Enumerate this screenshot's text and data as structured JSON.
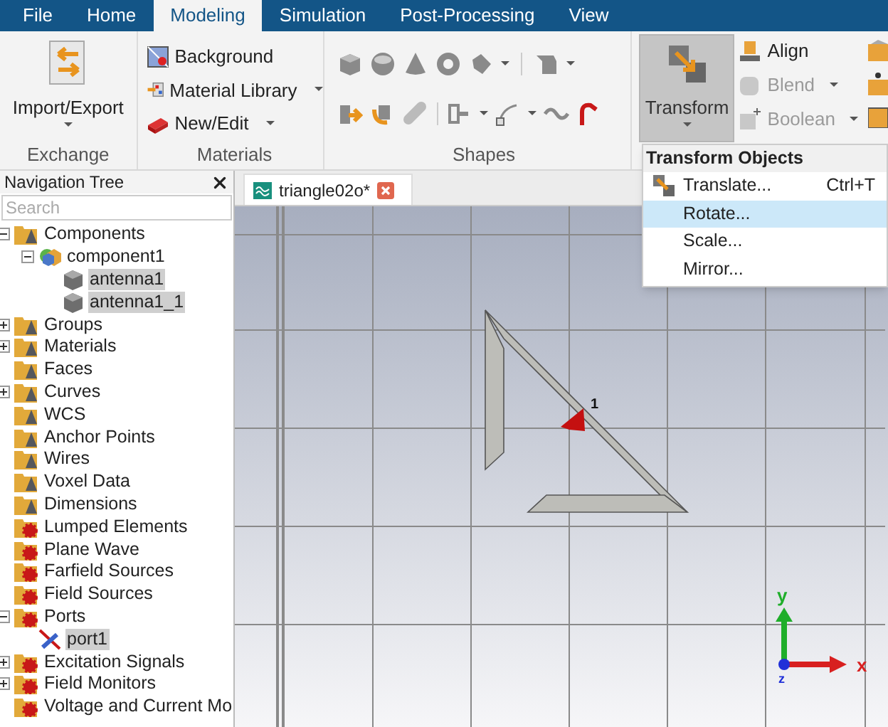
{
  "menu_bar": {
    "tabs": [
      {
        "label": "File",
        "selected": false
      },
      {
        "label": "Home",
        "selected": false
      },
      {
        "label": "Modeling",
        "selected": true
      },
      {
        "label": "Simulation",
        "selected": false
      },
      {
        "label": "Post-Processing",
        "selected": false
      },
      {
        "label": "View",
        "selected": false
      }
    ]
  },
  "ribbon": {
    "exchange": {
      "label": "Exchange",
      "button": {
        "label": "Import/Export"
      }
    },
    "materials": {
      "label": "Materials",
      "buttons": [
        {
          "label": "Background",
          "dropdown": false
        },
        {
          "label": "Material Library",
          "dropdown": true
        },
        {
          "label": "New/Edit",
          "dropdown": true
        }
      ]
    },
    "shapes": {
      "label": "Shapes"
    },
    "transform": {
      "large": {
        "label": "Transform",
        "selected": true
      },
      "buttons": [
        {
          "label": "Align",
          "disabled": false,
          "dropdown": false
        },
        {
          "label": "Blend",
          "disabled": true,
          "dropdown": true
        },
        {
          "label": "Boolean",
          "disabled": true,
          "dropdown": true
        }
      ]
    }
  },
  "transform_menu": {
    "header": "Transform Objects",
    "items": [
      {
        "label": "Translate...",
        "shortcut": "Ctrl+T",
        "selected": false
      },
      {
        "label": "Rotate...",
        "selected": true
      },
      {
        "label": "Scale...",
        "selected": false
      },
      {
        "label": "Mirror...",
        "selected": false
      }
    ]
  },
  "navigation_tree": {
    "title": "Navigation Tree",
    "search": {
      "placeholder": "Search"
    },
    "items": [
      {
        "label": "Components",
        "kind": "folder",
        "expanded": true,
        "selected": false,
        "children": [
          {
            "label": "component1",
            "kind": "component",
            "expanded": true,
            "selected": false,
            "children": [
              {
                "label": "antenna1",
                "kind": "solid",
                "selected": true
              },
              {
                "label": "antenna1_1",
                "kind": "solid",
                "selected": true
              }
            ]
          }
        ]
      },
      {
        "label": "Groups",
        "kind": "folder",
        "expanded": false,
        "selected": false
      },
      {
        "label": "Materials",
        "kind": "folder",
        "expanded": false,
        "selected": false
      },
      {
        "label": "Faces",
        "kind": "folder",
        "selected": false
      },
      {
        "label": "Curves",
        "kind": "folder",
        "expanded": false,
        "selected": false
      },
      {
        "label": "WCS",
        "kind": "folder",
        "selected": false
      },
      {
        "label": "Anchor Points",
        "kind": "folder",
        "selected": false
      },
      {
        "label": "Wires",
        "kind": "folder",
        "selected": false
      },
      {
        "label": "Voxel Data",
        "kind": "folder",
        "selected": false
      },
      {
        "label": "Dimensions",
        "kind": "folder",
        "selected": false
      },
      {
        "label": "Lumped Elements",
        "kind": "source",
        "selected": false
      },
      {
        "label": "Plane Wave",
        "kind": "source",
        "selected": false
      },
      {
        "label": "Farfield Sources",
        "kind": "source",
        "selected": false
      },
      {
        "label": "Field Sources",
        "kind": "source",
        "selected": false
      },
      {
        "label": "Ports",
        "kind": "source",
        "expanded": true,
        "selected": false,
        "children": [
          {
            "label": "port1",
            "kind": "port",
            "selected": true
          }
        ]
      },
      {
        "label": "Excitation Signals",
        "kind": "source",
        "expanded": false,
        "selected": false
      },
      {
        "label": "Field Monitors",
        "kind": "source",
        "expanded": false,
        "selected": false
      },
      {
        "label": "Voltage and Current Mo",
        "kind": "source",
        "selected": false
      }
    ]
  },
  "document_tab": {
    "label": "triangle02o*"
  },
  "viewport": {
    "port_label": "1",
    "axes": {
      "x": "x",
      "y": "y",
      "z": "z"
    }
  }
}
